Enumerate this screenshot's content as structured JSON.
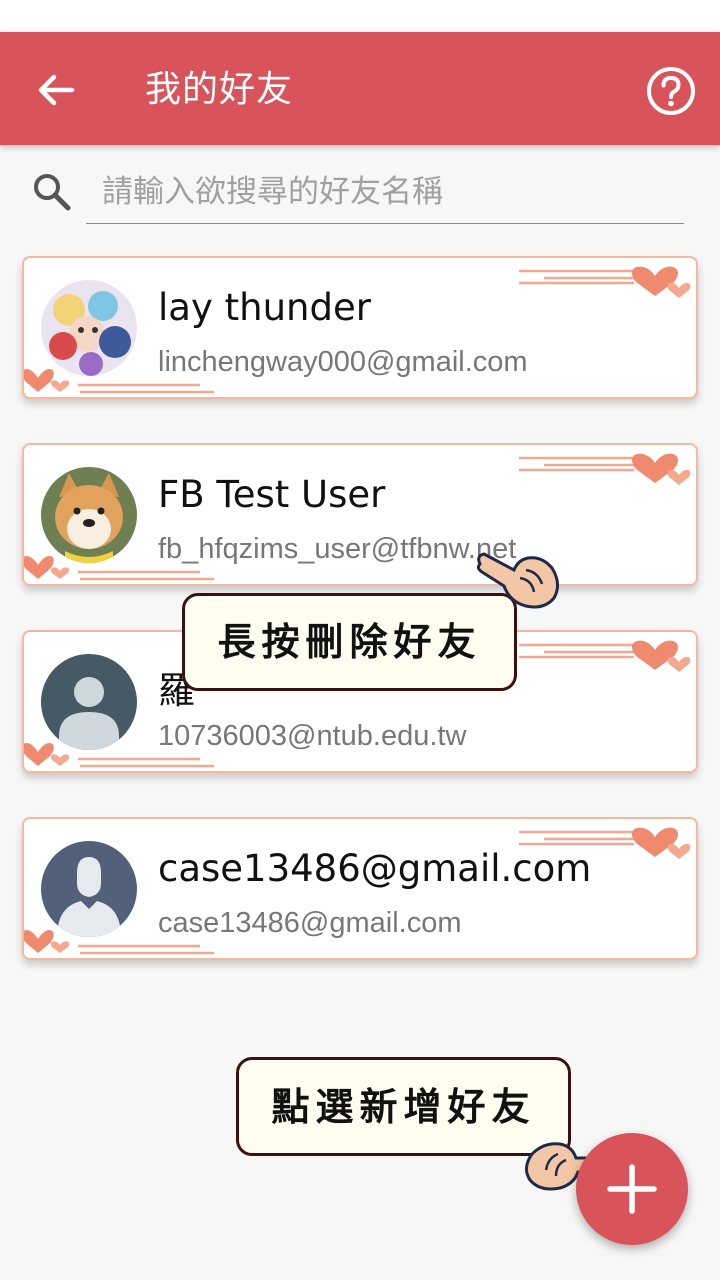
{
  "header": {
    "title": "我的好友",
    "back_icon": "arrow-left-icon",
    "help_icon": "help-circle-icon"
  },
  "search": {
    "placeholder": "請輸入欲搜尋的好友名稱",
    "value": ""
  },
  "friends": [
    {
      "name": "lay thunder",
      "email": "linchengway000@gmail.com",
      "avatar": "anime-group-avatar"
    },
    {
      "name": "FB Test User",
      "email": "fb_hfqzims_user@tfbnw.net",
      "avatar": "shiba-dog-avatar"
    },
    {
      "name": "羅",
      "email": "10736003@ntub.edu.tw",
      "avatar": "default-person-avatar"
    },
    {
      "name": "case13486@gmail.com",
      "email": "case13486@gmail.com",
      "avatar": "default-silhouette-avatar"
    }
  ],
  "tips": {
    "delete_hint": "長按刪除好友",
    "add_hint": "點選新增好友"
  },
  "colors": {
    "primary": "#d9545a",
    "card_border": "#f4b8a0",
    "heart": "#ef8a6e"
  }
}
